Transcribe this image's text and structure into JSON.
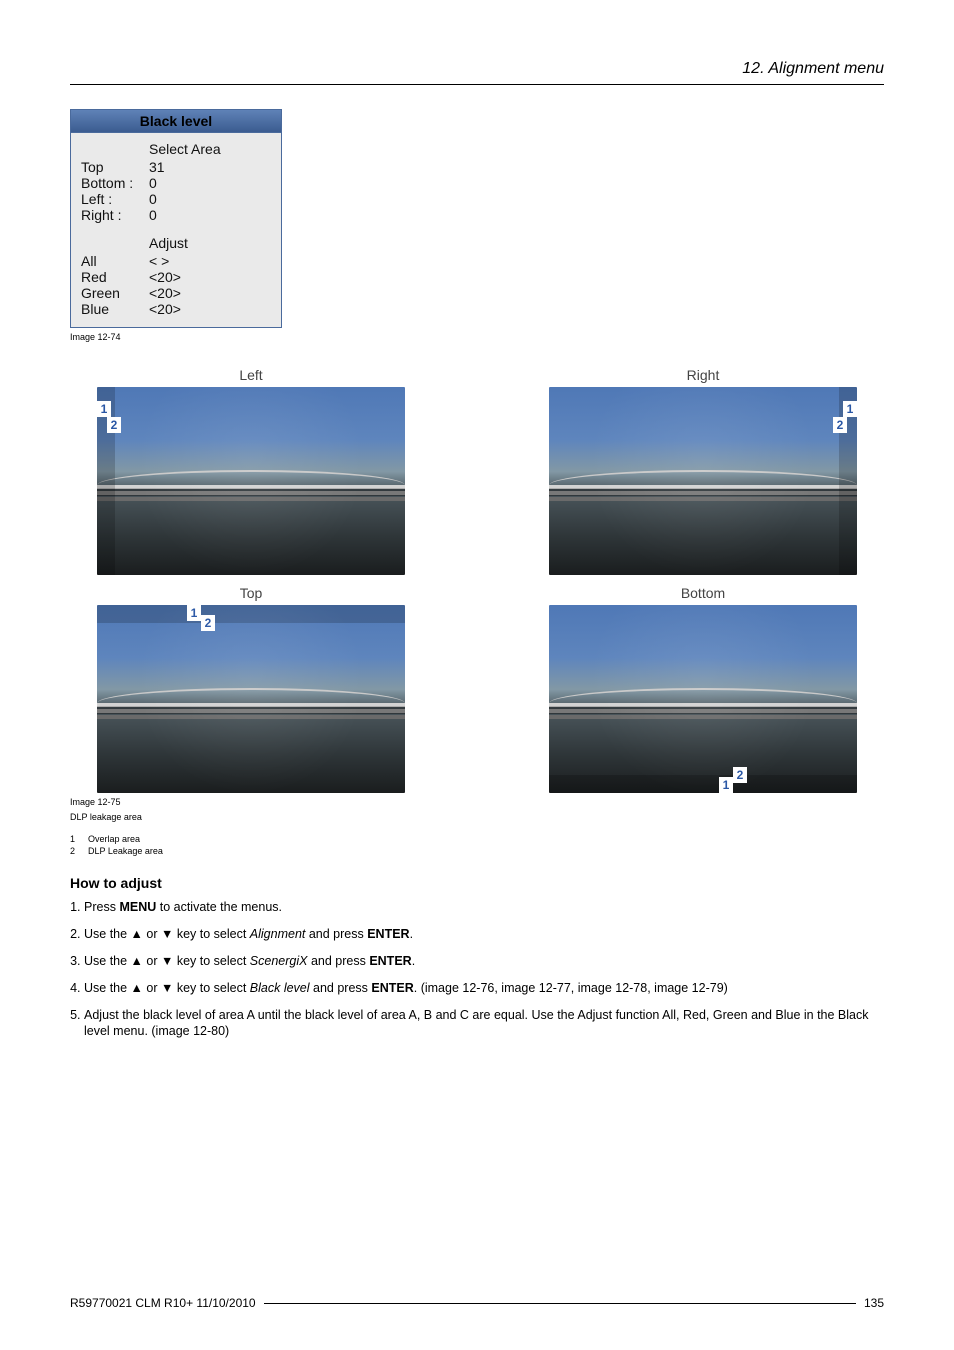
{
  "header": {
    "chapter": "12.  Alignment menu"
  },
  "osd": {
    "title": "Black level",
    "selectAreaLabel": "Select Area",
    "rows": [
      {
        "label": "Top",
        "value": "31"
      },
      {
        "label": "Bottom :",
        "value": "0"
      },
      {
        "label": "Left :",
        "value": "0"
      },
      {
        "label": "Right :",
        "value": "0"
      }
    ],
    "adjustLabel": "Adjust",
    "adjustRows": [
      {
        "label": "All",
        "value": "< >"
      },
      {
        "label": "Red",
        "value": "<20>"
      },
      {
        "label": "Green",
        "value": "<20>"
      },
      {
        "label": "Blue",
        "value": "<20>"
      }
    ],
    "caption": "Image 12-74"
  },
  "thumbs": {
    "left": "Left",
    "right": "Right",
    "top": "Top",
    "bottom": "Bottom",
    "tag1": "1",
    "tag2": "2",
    "caption": "Image 12-75",
    "captionSub": "DLP leakage area",
    "legend1": "Overlap area",
    "legend2": "DLP Leakage area",
    "legendNum1": "1",
    "legendNum2": "2"
  },
  "howto": {
    "heading": "How to adjust",
    "steps": [
      {
        "pre": "Press ",
        "b1": "MENU",
        "post": " to activate the menus."
      },
      {
        "pre": "Use the ▲ or ▼ key to select ",
        "i1": "Alignment",
        "mid": " and press ",
        "b1": "ENTER",
        "post": "."
      },
      {
        "pre": "Use the ▲ or ▼ key to select ",
        "i1": "ScenergiX",
        "mid": " and press ",
        "b1": "ENTER",
        "post": "."
      },
      {
        "pre": "Use the ▲ or ▼ key to select ",
        "i1": "Black level",
        "mid": " and press ",
        "b1": "ENTER",
        "post": ". (image 12-76, image 12-77, image 12-78, image 12-79)"
      },
      {
        "pre": "Adjust the black level of area A until the black level of area A, B and C are equal.  Use the Adjust function All, Red, Green and Blue in the Black level menu.  (image 12-80)"
      }
    ]
  },
  "footer": {
    "left": "R59770021  CLM R10+  11/10/2010",
    "right": "135"
  }
}
